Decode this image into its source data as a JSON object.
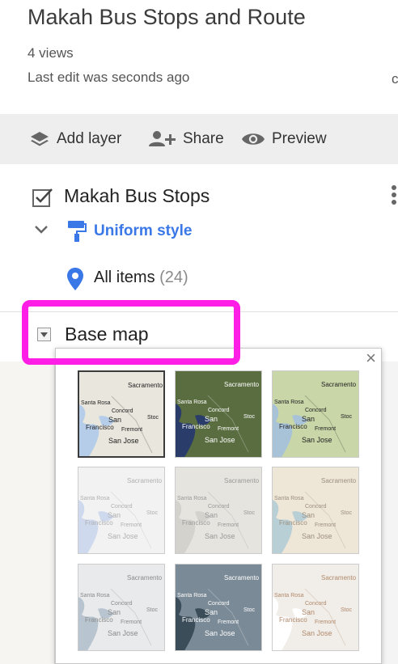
{
  "map": {
    "title": "Makah Bus Stops and Route",
    "views": "4 views",
    "last_edit": "Last edit was seconds ago",
    "cut_text": "c"
  },
  "toolbar": {
    "add_layer": "Add layer",
    "share": "Share",
    "preview": "Preview"
  },
  "layer": {
    "name": "Makah Bus Stops",
    "checked": true,
    "style_label": "Uniform style",
    "all_items_label": "All items",
    "all_items_count": "(24)"
  },
  "basemap": {
    "label": "Base map",
    "close": "×",
    "tiles": [
      {
        "id": "map",
        "selected": true,
        "land": "#e9e6dd",
        "water": "#b5cde8",
        "text": "#222222"
      },
      {
        "id": "satellite",
        "selected": false,
        "land": "#5a6d40",
        "water": "#2a3d6a",
        "text": "#ffffff"
      },
      {
        "id": "terrain",
        "selected": false,
        "land": "#c9d6a8",
        "water": "#a8c3d8",
        "text": "#222222"
      },
      {
        "id": "light-political",
        "selected": false,
        "land": "#f2f2f2",
        "water": "#cfd9ee",
        "text": "#b0b0b0"
      },
      {
        "id": "mono-city",
        "selected": false,
        "land": "#e6e4df",
        "water": "#d4d2cc",
        "text": "#999999"
      },
      {
        "id": "simple-atlas",
        "selected": false,
        "land": "#eee6d6",
        "water": "#b9cfd6",
        "text": "#9c8f80"
      },
      {
        "id": "light-landmass",
        "selected": false,
        "land": "#e8eaec",
        "water": "#b8c4cf",
        "text": "#8a8a8a"
      },
      {
        "id": "dark-landmass",
        "selected": false,
        "land": "#7a8a96",
        "water": "#3c4d5a",
        "text": "#ffffff"
      },
      {
        "id": "whitewater",
        "selected": false,
        "land": "#f1ede8",
        "water": "#ffffff",
        "text": "#b08a6c"
      }
    ],
    "tile_labels": {
      "sacramento": "Sacramento",
      "santa_rosa": "Santa Rosa",
      "concord": "Concord",
      "san": "San",
      "francisco": "Francisco",
      "stockton": "Stoc",
      "fremont": "Fremont",
      "san_jose": "San Jose"
    }
  },
  "colors": {
    "accent_blue": "#3b78e7",
    "highlight": "#ff1ee6",
    "toolbar_bg": "#eeeeee"
  }
}
